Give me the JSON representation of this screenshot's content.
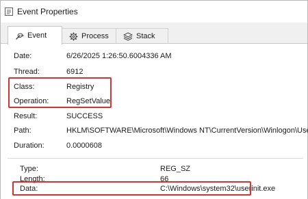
{
  "window": {
    "title": "Event Properties",
    "title_icon": "event-properties-icon"
  },
  "tabs": [
    {
      "label": "Event",
      "icon": "wrench-icon",
      "active": true
    },
    {
      "label": "Process",
      "icon": "gear-icon",
      "active": false
    },
    {
      "label": "Stack",
      "icon": "stack-icon",
      "active": false
    }
  ],
  "event": {
    "date_label": "Date:",
    "date_value": "6/26/2025 1:26:50.6004336 AM",
    "thread_label": "Thread:",
    "thread_value": "6912",
    "class_label": "Class:",
    "class_value": "Registry",
    "operation_label": "Operation:",
    "operation_value": "RegSetValue",
    "result_label": "Result:",
    "result_value": "SUCCESS",
    "path_label": "Path:",
    "path_value": "HKLM\\SOFTWARE\\Microsoft\\Windows NT\\CurrentVersion\\Winlogon\\Userinit",
    "duration_label": "Duration:",
    "duration_value": "0.0000608"
  },
  "details": {
    "type_label": "Type:",
    "type_value": "REG_SZ",
    "length_label": "Length:",
    "length_value": "66",
    "data_label": "Data:",
    "data_value": "C:\\Windows\\system32\\userinit.exe"
  },
  "highlight_color": "#d9312b"
}
